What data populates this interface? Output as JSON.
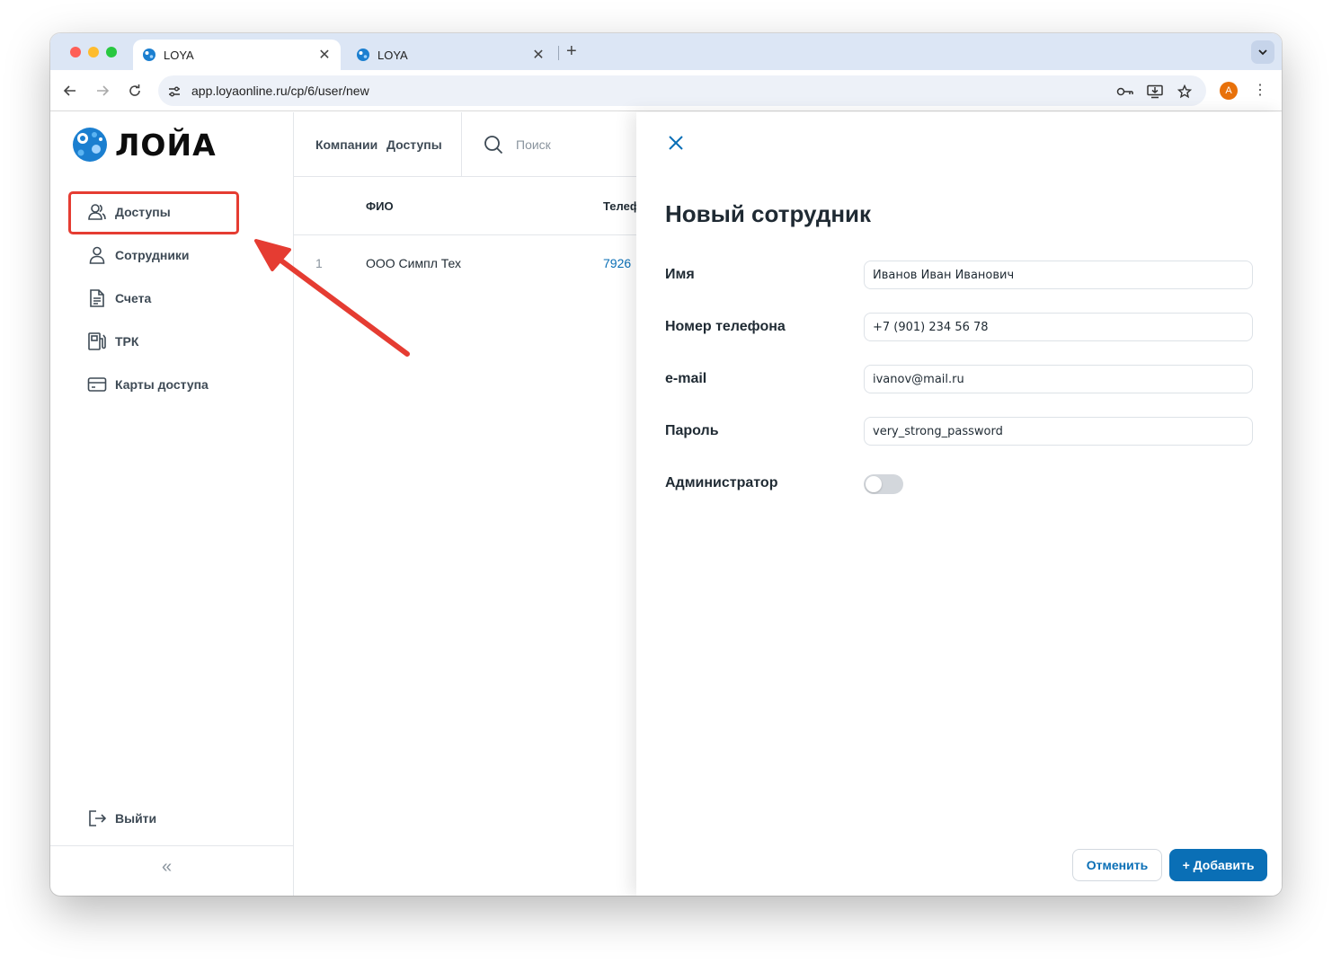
{
  "browser": {
    "tabs": [
      {
        "title": "LOYA",
        "close": "✕"
      },
      {
        "title": "LOYA",
        "close": "✕"
      }
    ],
    "new_tab": "+",
    "url": "app.loyaonline.ru/cp/6/user/new",
    "profile_initial": "A"
  },
  "sidebar": {
    "logo_text": "ЛОЙА",
    "items": [
      {
        "label": "Доступы",
        "icon": "users-icon"
      },
      {
        "label": "Сотрудники",
        "icon": "user-icon"
      },
      {
        "label": "Счета",
        "icon": "document-icon"
      },
      {
        "label": "ТРК",
        "icon": "fuel-pump-icon"
      },
      {
        "label": "Карты доступа",
        "icon": "card-icon"
      }
    ],
    "logout": "Выйти",
    "collapse": "«"
  },
  "main": {
    "breadcrumb": [
      "Компании",
      "Доступы"
    ],
    "search_placeholder": "Поиск",
    "columns": [
      "ФИО",
      "Телеф"
    ],
    "rows": [
      {
        "index": "1",
        "name": "ООО Симпл Тех",
        "phone": "7926"
      }
    ]
  },
  "panel": {
    "title": "Новый сотрудник",
    "fields": [
      {
        "label": "Имя",
        "value": "Иванов Иван Иванович"
      },
      {
        "label": "Номер телефона",
        "value": "+7 (901) 234 56 78"
      },
      {
        "label": "e-mail",
        "value": "ivanov@mail.ru"
      },
      {
        "label": "Пароль",
        "value": "very_strong_password"
      }
    ],
    "admin_label": "Администратор",
    "admin_enabled": false,
    "cancel_label": "Отменить",
    "add_label": "+ Добавить"
  },
  "colors": {
    "accent": "#0a6fb6",
    "highlight": "#e53c32",
    "tabbar": "#dce6f5"
  }
}
